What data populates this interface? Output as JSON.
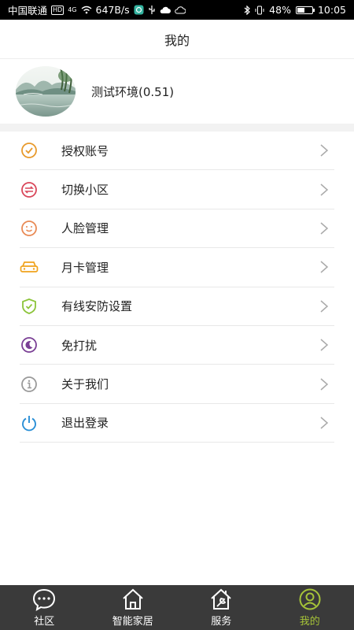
{
  "status_bar": {
    "carrier": "中国联通",
    "hd": "HD",
    "network": "4G",
    "speed": "647B/s",
    "battery": "48%",
    "battery_level": 0.48,
    "time": "10:05"
  },
  "header": {
    "title": "我的"
  },
  "profile": {
    "name": "测试环境(0.51)"
  },
  "menu": {
    "items": [
      {
        "label": "授权账号",
        "icon": "check-circle-icon",
        "color": "#e89a2c"
      },
      {
        "label": "切换小区",
        "icon": "swap-circle-icon",
        "color": "#d9475a"
      },
      {
        "label": "人脸管理",
        "icon": "smile-face-icon",
        "color": "#e98a55"
      },
      {
        "label": "月卡管理",
        "icon": "car-icon",
        "color": "#f0a31c"
      },
      {
        "label": "有线安防设置",
        "icon": "shield-check-icon",
        "color": "#8cc43a"
      },
      {
        "label": "免打扰",
        "icon": "moon-icon",
        "color": "#7a3f95"
      },
      {
        "label": "关于我们",
        "icon": "info-circle-icon",
        "color": "#9a9a9a"
      },
      {
        "label": "退出登录",
        "icon": "power-icon",
        "color": "#2a8fd6"
      }
    ]
  },
  "tabs": [
    {
      "label": "社区",
      "icon": "chat-bubble-icon",
      "active": false
    },
    {
      "label": "智能家居",
      "icon": "house-icon",
      "active": false
    },
    {
      "label": "服务",
      "icon": "tools-icon",
      "active": false
    },
    {
      "label": "我的",
      "icon": "user-circle-icon",
      "active": true
    }
  ],
  "colors": {
    "active_tab": "#a6c438",
    "tab_bar_bg": "#3a3a3a"
  }
}
